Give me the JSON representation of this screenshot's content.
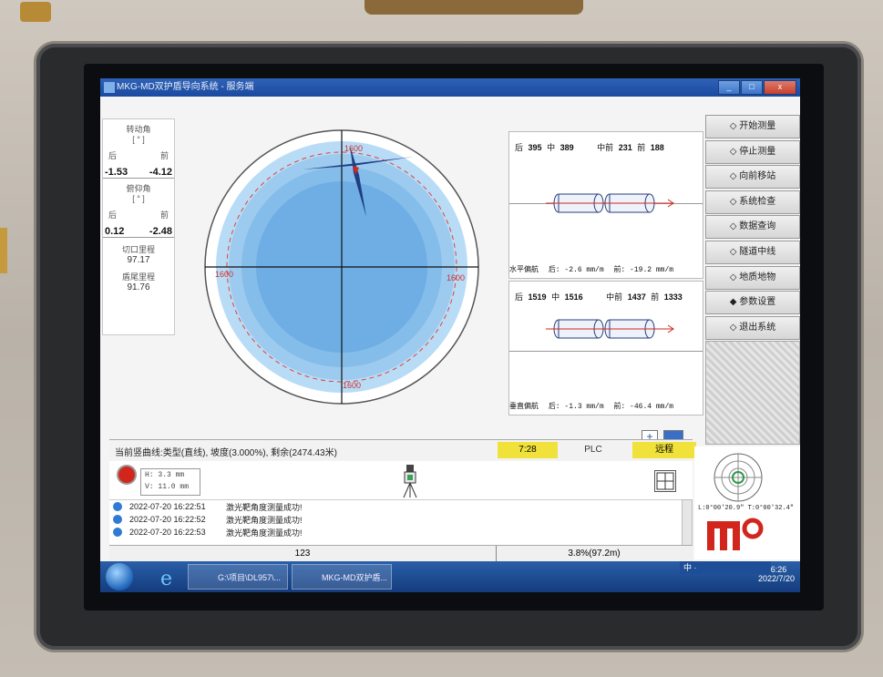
{
  "window": {
    "title": "MKG-MD双护盾导向系统 - 服务端",
    "btn_min": "_",
    "btn_max": "□",
    "btn_close": "x"
  },
  "left_panel": {
    "roll_title": "转动角",
    "roll_unit": "[ ° ]",
    "rear_label": "后",
    "front_label": "前",
    "roll_rear": "-1.53",
    "roll_front": "-4.12",
    "pitch_title": "俯仰角",
    "pitch_unit": "[ ° ]",
    "pitch_rear": "0.12",
    "pitch_front": "-2.48",
    "cutter_mileage_label": "切口里程",
    "cutter_mileage": "97.17",
    "tail_mileage_label": "盾尾里程",
    "tail_mileage": "91.76"
  },
  "radar": {
    "scale_top": "1600",
    "scale_left": "1600",
    "scale_right": "1600",
    "scale_bottom": "1600"
  },
  "horizontal": {
    "rear_label": "后",
    "rear": "395",
    "mid_label": "中",
    "mid": "389",
    "midfront_label": "中前",
    "midfront": "231",
    "front_label": "前",
    "front": "188",
    "title": "水平偏航",
    "rear_dev": "后:  -2.6 mm/m",
    "front_dev": "前: -19.2 mm/m"
  },
  "vertical": {
    "rear_label": "后",
    "rear": "1519",
    "mid_label": "中",
    "mid": "1516",
    "midfront_label": "中前",
    "midfront": "1437",
    "front_label": "前",
    "front": "1333",
    "title": "垂直偏航",
    "rear_dev": "后:  -1.3 mm/m",
    "front_dev": "前: -46.4 mm/m"
  },
  "menu": [
    {
      "label": "◇ 开始测量"
    },
    {
      "label": "◇ 停止测量"
    },
    {
      "label": "◇ 向前移站"
    },
    {
      "label": "◇ 系统检查"
    },
    {
      "label": "◇ 数据查询"
    },
    {
      "label": "◇ 隧道中线"
    },
    {
      "label": "◇ 地质地物"
    },
    {
      "label": "◆ 参数设置"
    },
    {
      "label": "◇ 退出系统"
    }
  ],
  "status": {
    "curve_text": "当前竖曲线:类型(直线), 坡度(3.000%), 剩余(2474.43米)",
    "time": "7:28",
    "plc": "PLC",
    "remote": "远程"
  },
  "hv_box": {
    "h": "H: 3.3 mm",
    "v": "V: 11.0 mm"
  },
  "log": [
    {
      "time": "2022-07-20 16:22:51",
      "msg": "激光靶角度测量成功!"
    },
    {
      "time": "2022-07-20 16:22:52",
      "msg": "激光靶角度测量成功!"
    },
    {
      "time": "2022-07-20 16:22:53",
      "msg": "激光靶角度测量成功!"
    }
  ],
  "bottom": {
    "left": "123",
    "right": "3.8%(97.2m)"
  },
  "compass_text": "L:0°00'20.9\" T:0°00'32.4\"",
  "taskbar": {
    "task1": "G:\\项目\\DL957\\...",
    "task2": "MKG-MD双护盾...",
    "ime": "中 ·",
    "clock_time": "16:26",
    "clock_date": "2022/7/20"
  },
  "colors": {
    "accent_yellow": "#f0e23a",
    "title_blue": "#1b4aa0",
    "logo_red": "#d2261c"
  }
}
